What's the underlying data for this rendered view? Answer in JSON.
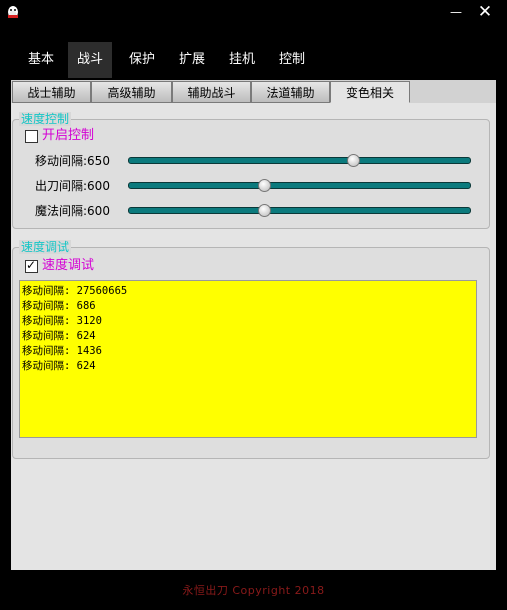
{
  "window": {
    "minimize_glyph": "—",
    "close_glyph": "✕"
  },
  "tabs": [
    {
      "label": "基本",
      "active": false
    },
    {
      "label": "战斗",
      "active": true
    },
    {
      "label": "保护",
      "active": false
    },
    {
      "label": "扩展",
      "active": false
    },
    {
      "label": "挂机",
      "active": false
    },
    {
      "label": "控制",
      "active": false
    }
  ],
  "subtabs": [
    {
      "label": "战士辅助",
      "active": false
    },
    {
      "label": "高级辅助",
      "active": false
    },
    {
      "label": "辅助战斗",
      "active": false
    },
    {
      "label": "法道辅助",
      "active": false
    },
    {
      "label": "变色相关",
      "active": true
    }
  ],
  "speed_control": {
    "title": "速度控制",
    "enable_label": "开启控制",
    "enable_checked": false,
    "sliders": [
      {
        "label": "移动间隔:650",
        "level": 0.66
      },
      {
        "label": "出刀间隔:600",
        "level": 0.4
      },
      {
        "label": "魔法间隔:600",
        "level": 0.4
      }
    ]
  },
  "speed_debug": {
    "title": "速度调试",
    "checkbox_label": "速度调试",
    "checked": true,
    "log_lines": [
      "移动间隔: 27560665",
      "移动间隔: 686",
      "移动间隔: 3120",
      "移动间隔: 624",
      "移动间隔: 1436",
      "移动间隔: 624"
    ]
  },
  "footer": "永恒出刀   Copyright 2018",
  "colors": {
    "group_title": "#12c6c6",
    "checkbox_label": "#d400d4",
    "log_background": "#ffff00",
    "slider_track": "#0b7a7d"
  }
}
